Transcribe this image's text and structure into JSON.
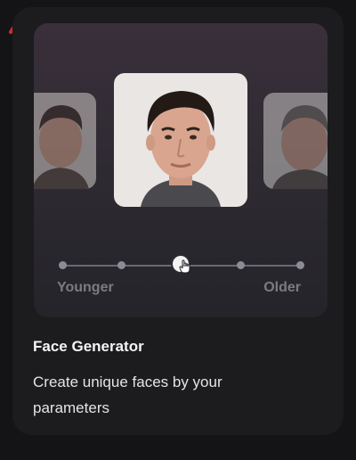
{
  "watermark": {
    "text": "تابناک جوان",
    "color": "#d62a2a"
  },
  "slider": {
    "min_label": "Younger",
    "max_label": "Older",
    "steps": 5,
    "selected_step": 3
  },
  "card": {
    "title": "Face Generator",
    "description": "Create unique faces by your parameters"
  },
  "icons": {
    "thumb": "hand-pointer-icon"
  },
  "colors": {
    "background": "#141416",
    "card": "#1c1c1f",
    "text_primary": "#f4f4f4",
    "text_muted": "#7b7b83"
  }
}
